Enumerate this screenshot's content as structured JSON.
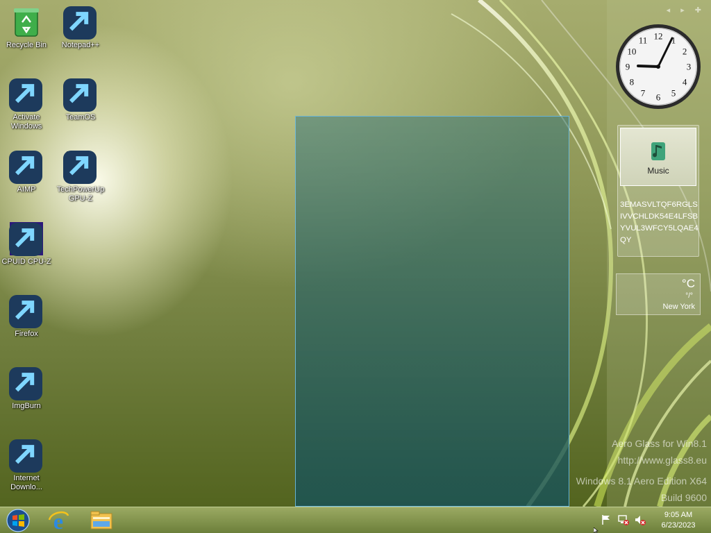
{
  "desktop_icons": [
    {
      "label": "Recycle Bin",
      "icon": "recycle-bin-icon"
    },
    {
      "label": "Notepad++",
      "icon": "notepad-plus-plus-icon"
    },
    {
      "label": "Activate Windows",
      "icon": "key-icon"
    },
    {
      "label": "TeamOS",
      "icon": "teamos-icon"
    },
    {
      "label": "AIMP",
      "icon": "aimp-icon"
    },
    {
      "label": "TechPowerUp GPU-Z",
      "icon": "gpu-z-icon"
    },
    {
      "label": "CPUID CPU-Z",
      "icon": "cpu-z-icon"
    },
    {
      "label": "Firefox",
      "icon": "firefox-icon"
    },
    {
      "label": "ImgBurn",
      "icon": "imgburn-icon"
    },
    {
      "label": "Internet Downlo...",
      "icon": "internet-download-manager-icon"
    }
  ],
  "gadgets": {
    "clock": {
      "time": "9:05",
      "numbers": [
        "12",
        "1",
        "2",
        "3",
        "4",
        "5",
        "6",
        "7",
        "8",
        "9",
        "10",
        "11"
      ]
    },
    "music": {
      "label": "Music",
      "serial": "3EMASVLTQF6RGLSIVVCHLDK54E4LFSBYVUL3WFCY5LQAE4QY"
    },
    "weather": {
      "unit": "°C",
      "range": "°/°",
      "city": "New York"
    }
  },
  "watermark": {
    "line1": "Aero Glass for Win8.1",
    "line2": "http://www.glass8.eu",
    "line3": "Windows 8.1 Aero Edition X64",
    "line4": "Build 9600"
  },
  "taskbar": {
    "pinned": [
      "start-orb-icon",
      "internet-explorer-icon",
      "file-explorer-icon"
    ],
    "tray": [
      "action-center-flag-icon",
      "network-disconnected-icon",
      "volume-muted-icon"
    ],
    "time": "9:05 AM",
    "date": "6/23/2023"
  },
  "colors": {
    "selection_border": "#6ebee6",
    "taskbar": "#7d8f45"
  }
}
